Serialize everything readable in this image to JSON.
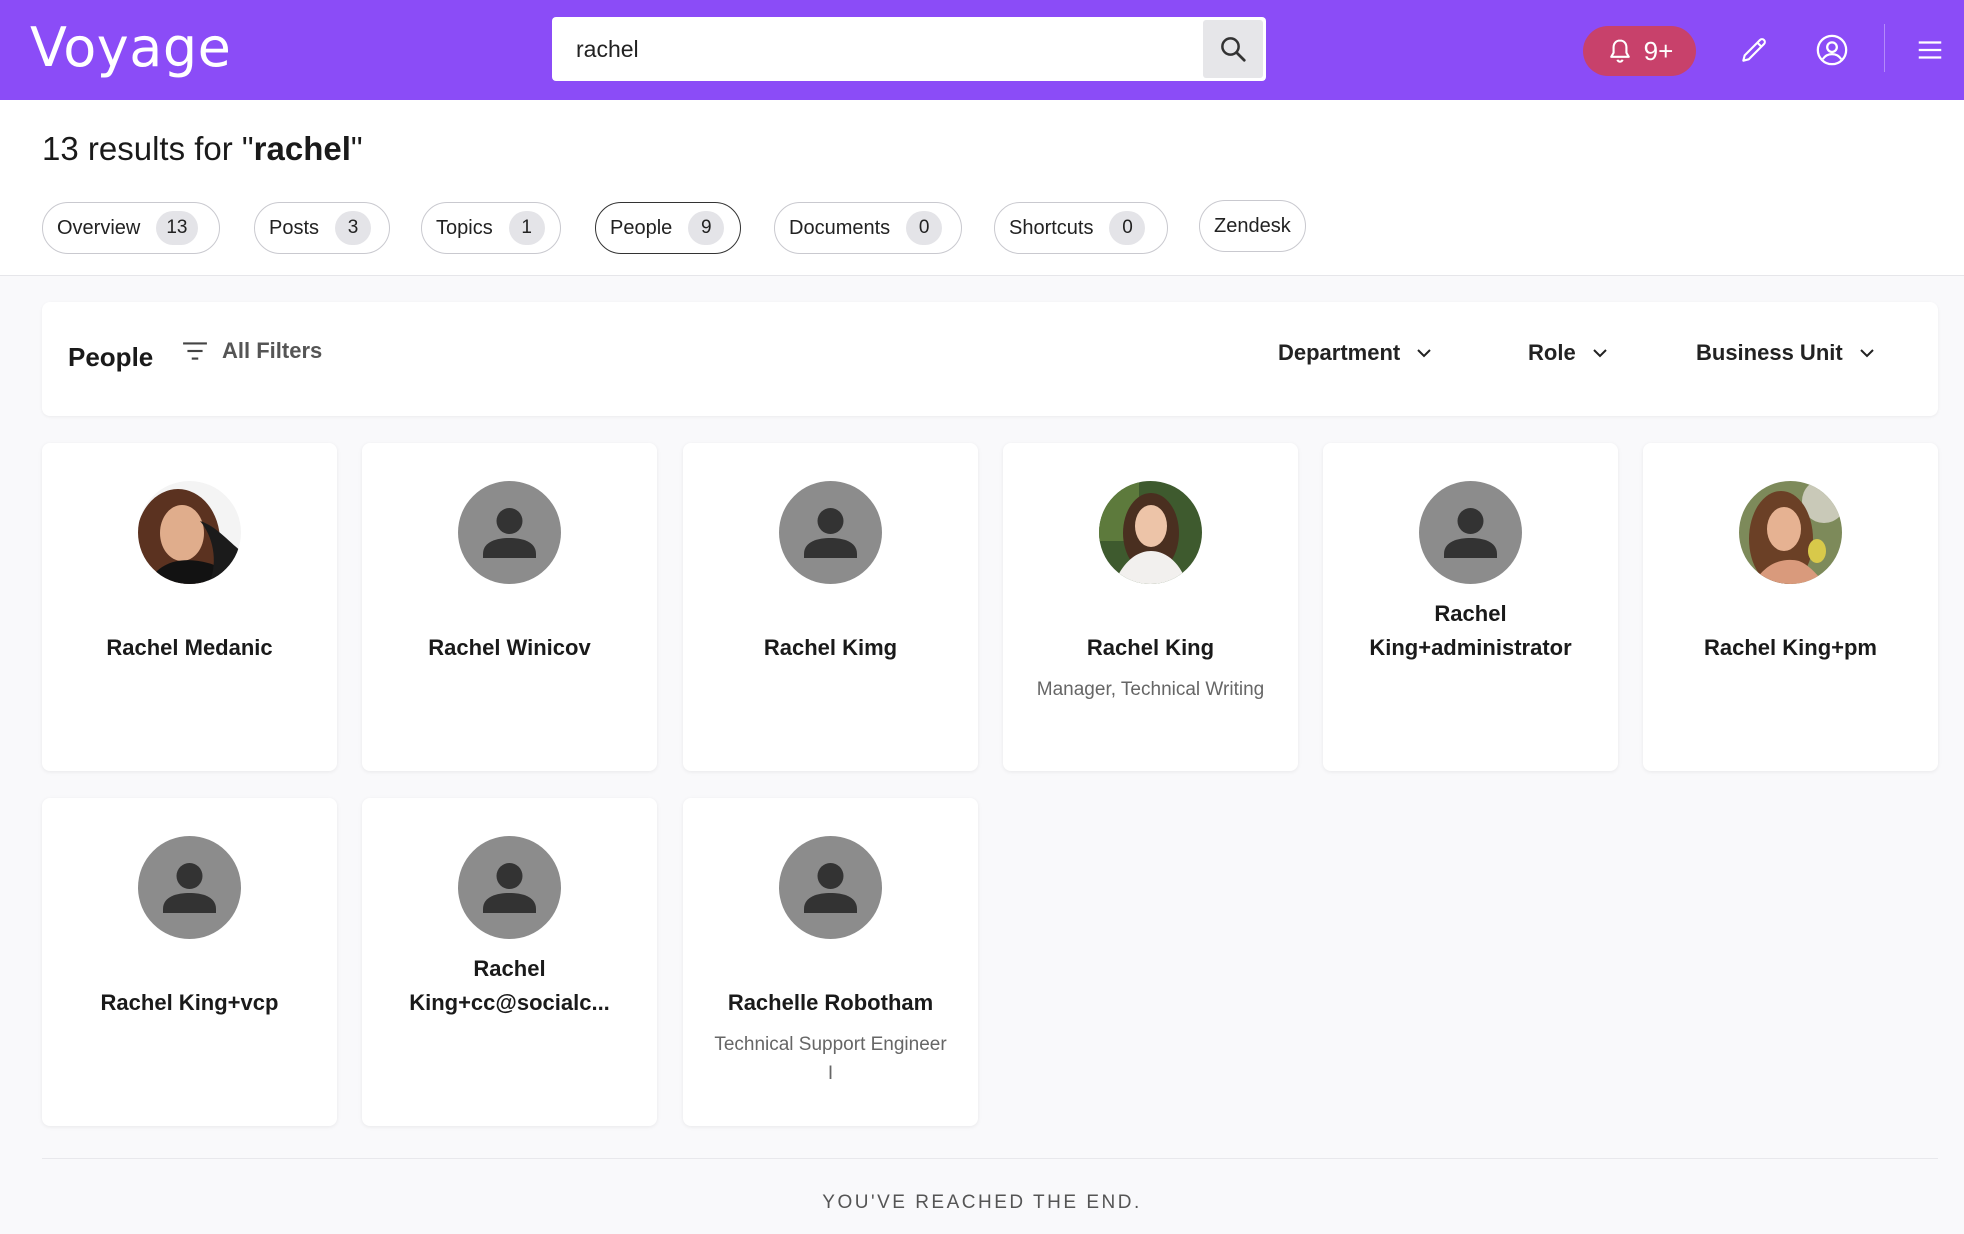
{
  "app": {
    "logo": "Voyage"
  },
  "header": {
    "search_value": "rachel",
    "notifications_badge": "9+"
  },
  "results": {
    "prefix": "13 results for \"",
    "query": "rachel",
    "suffix": "\""
  },
  "tabs": [
    {
      "label": "Overview",
      "count": "13"
    },
    {
      "label": "Posts",
      "count": "3"
    },
    {
      "label": "Topics",
      "count": "1"
    },
    {
      "label": "People",
      "count": "9",
      "active": true
    },
    {
      "label": "Documents",
      "count": "0"
    },
    {
      "label": "Shortcuts",
      "count": "0"
    },
    {
      "label": "Zendesk"
    }
  ],
  "filterbar": {
    "title": "People",
    "all_filters": "All Filters",
    "dropdowns": [
      "Department",
      "Role",
      "Business Unit"
    ]
  },
  "people": [
    {
      "name": "Rachel Medanic",
      "subtitle": "",
      "photo": true
    },
    {
      "name": "Rachel Winicov",
      "subtitle": "",
      "photo": false
    },
    {
      "name": "Rachel Kimg",
      "subtitle": "",
      "photo": false
    },
    {
      "name": "Rachel King",
      "subtitle": "Manager, Technical Writing",
      "photo": true
    },
    {
      "name": "Rachel King+administrator",
      "subtitle": "",
      "photo": false
    },
    {
      "name": "Rachel King+pm",
      "subtitle": "",
      "photo": true
    },
    {
      "name": "Rachel King+vcp",
      "subtitle": "",
      "photo": false
    },
    {
      "name": "Rachel King+cc@socialc...",
      "subtitle": "",
      "photo": false
    },
    {
      "name": "Rachelle Robotham",
      "subtitle": "Technical Support Engineer I",
      "photo": false
    }
  ],
  "footer": {
    "end_text": "YOU'VE REACHED THE END."
  },
  "colors": {
    "brand": "#8b4cf7",
    "notification": "#c8416b",
    "avatar_placeholder": "#8c8c8c"
  },
  "icons": {
    "search": "search-icon",
    "notifications": "bell-icon",
    "edit": "pencil-icon",
    "profile": "user-circle-icon",
    "menu": "hamburger-menu-icon",
    "filters": "filter-lines-icon",
    "dropdown": "chevron-down-icon",
    "placeholder_avatar": "person-icon"
  }
}
